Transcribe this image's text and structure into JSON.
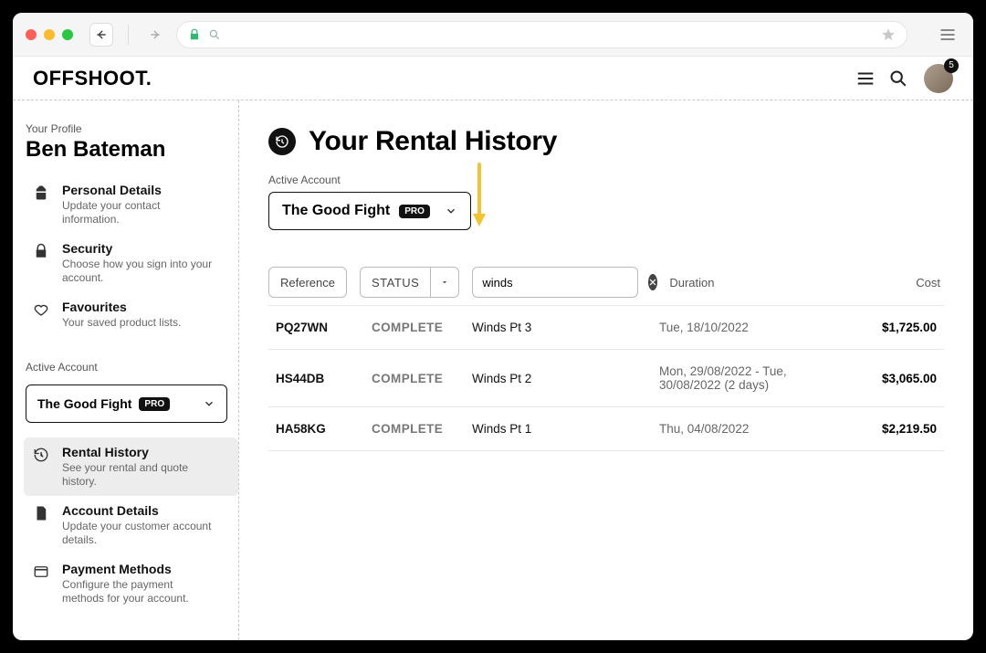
{
  "brand": "OFFSHOOT.",
  "notifications_count": "5",
  "profile": {
    "section_label": "Your Profile",
    "name": "Ben Bateman",
    "items": [
      {
        "icon": "badge-icon",
        "title": "Personal Details",
        "desc": "Update your contact information."
      },
      {
        "icon": "lock-icon",
        "title": "Security",
        "desc": "Choose how you sign into your account."
      },
      {
        "icon": "heart-icon",
        "title": "Favourites",
        "desc": "Your saved product lists."
      }
    ]
  },
  "account": {
    "section_label": "Active Account",
    "name": "The Good Fight",
    "tier": "PRO",
    "items": [
      {
        "icon": "history-icon",
        "title": "Rental History",
        "desc": "See your rental and quote history.",
        "active": true
      },
      {
        "icon": "document-icon",
        "title": "Account Details",
        "desc": "Update your customer account details."
      },
      {
        "icon": "card-icon",
        "title": "Payment Methods",
        "desc": "Configure the payment methods for your account."
      }
    ]
  },
  "page": {
    "title": "Your Rental History",
    "account_label": "Active Account"
  },
  "filters": {
    "reference_label": "Reference",
    "status_label": "STATUS",
    "search_value": "winds",
    "duration_label": "Duration",
    "cost_label": "Cost"
  },
  "rows": [
    {
      "ref": "PQ27WN",
      "status": "COMPLETE",
      "title": "Winds Pt 3",
      "duration": "Tue, 18/10/2022",
      "cost": "$1,725.00"
    },
    {
      "ref": "HS44DB",
      "status": "COMPLETE",
      "title": "Winds Pt 2",
      "duration": "Mon, 29/08/2022 - Tue, 30/08/2022 (2 days)",
      "cost": "$3,065.00"
    },
    {
      "ref": "HA58KG",
      "status": "COMPLETE",
      "title": "Winds Pt 1",
      "duration": "Thu, 04/08/2022",
      "cost": "$2,219.50"
    }
  ]
}
